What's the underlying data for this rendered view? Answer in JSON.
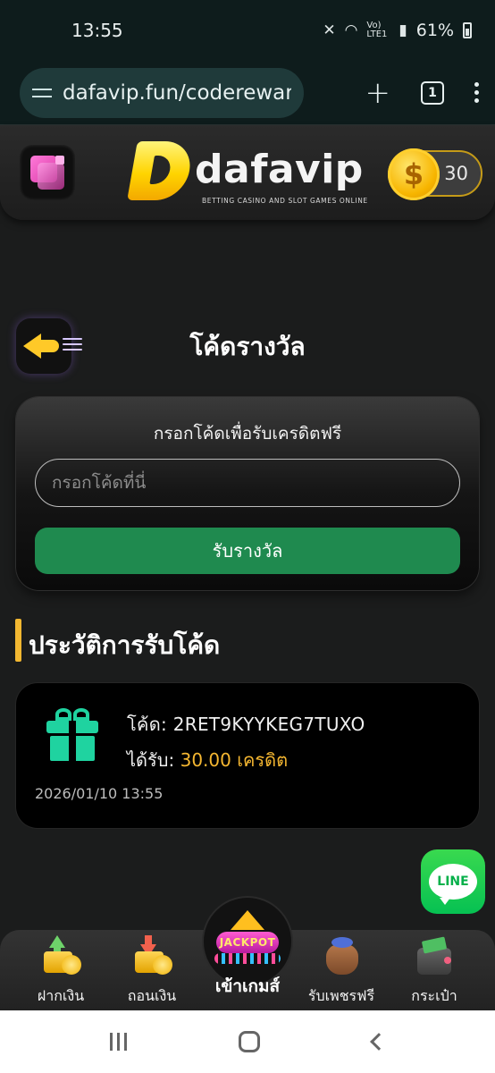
{
  "status_bar": {
    "time": "13:55",
    "network_label": "Vo) LTE1",
    "battery": "61%",
    "icons": [
      "mute-icon",
      "wifi-icon",
      "signal-icon",
      "battery-icon"
    ]
  },
  "browser": {
    "url": "dafavip.fun/coderewar",
    "tab_count": "1",
    "icons": [
      "site-settings-icon",
      "new-tab-icon",
      "tab-switcher-icon",
      "more-menu-icon"
    ]
  },
  "header": {
    "brand": "dafavip",
    "tagline": "BETTING CASINO AND SLOT GAMES ONLINE",
    "coin_symbol": "$",
    "credit_balance": "30"
  },
  "page": {
    "title": "โค้ดรางวัล"
  },
  "redeem": {
    "label": "กรอกโค้ดเพื่อรับเครดิตฟรี",
    "input_placeholder": "กรอกโค้ดที่นี่",
    "input_value": "",
    "button_label": "รับรางวัล"
  },
  "history": {
    "title": "ประวัติการรับโค้ด",
    "items": [
      {
        "code_label": "โค้ด:",
        "code": "2RET9KYYKEG7TUXO",
        "reward_label": "ได้รับ:",
        "reward_amount": "30.00 เครดิต",
        "datetime": "2026/01/10 13:55"
      }
    ]
  },
  "line_button": {
    "label": "LINE"
  },
  "bottom_nav": {
    "items": [
      {
        "label": "ฝากเงิน",
        "icon": "deposit-icon"
      },
      {
        "label": "ถอนเงิน",
        "icon": "withdraw-icon"
      },
      {
        "label": "เข้าเกมส์",
        "icon": "jackpot-icon",
        "badge": "JACKPOT"
      },
      {
        "label": "รับเพชรฟรี",
        "icon": "gem-bag-icon"
      },
      {
        "label": "กระเป๋า",
        "icon": "wallet-icon"
      }
    ]
  },
  "colors": {
    "background": "#1b1c1c",
    "accent_green": "#1f8a4f",
    "accent_gold": "#f5b731",
    "gift_teal": "#1fd3a0",
    "line_green": "#06c152"
  }
}
